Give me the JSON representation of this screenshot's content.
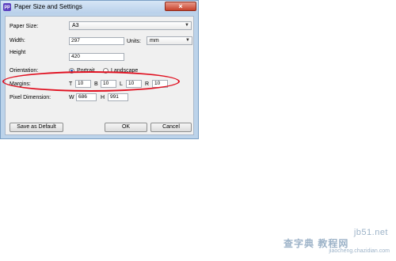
{
  "dialog": {
    "title": "Paper Size and Settings",
    "app_icon_text": "pp",
    "close_glyph": "×"
  },
  "form": {
    "paper_size_label": "Paper Size:",
    "paper_size_value": "A3",
    "width_label": "Width:",
    "width_value": "297",
    "units_label": "Units:",
    "units_value": "mm",
    "height_label": "Height",
    "height_value": "420",
    "orientation_label": "Orientation:",
    "portrait_label": "Portrait",
    "landscape_label": "Landscape",
    "orientation_selected": "Portrait",
    "margins_label": "Margins:",
    "margin_t_label": "T",
    "margin_t_value": "10",
    "margin_b_label": "B",
    "margin_b_value": "10",
    "margin_l_label": "L",
    "margin_l_value": "10",
    "margin_r_label": "R",
    "margin_r_value": "10",
    "pixel_dimension_label": "Pixel Dimension:",
    "pixel_w_label": "W",
    "pixel_w_value": "686",
    "pixel_h_label": "H",
    "pixel_h_value": "991"
  },
  "buttons": {
    "save_default": "Save as Default",
    "ok": "OK",
    "cancel": "Cancel"
  },
  "watermark": {
    "site": "jb51.net",
    "cn_text": "查字典 教程网",
    "url": "jiaocheng.chazidian.com"
  },
  "colors": {
    "annotation": "#e01020",
    "title_bar": "#bcd3ea",
    "close_button": "#c7432c"
  }
}
